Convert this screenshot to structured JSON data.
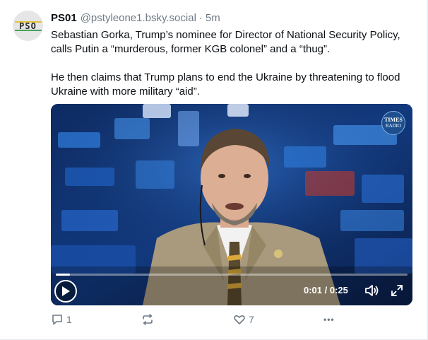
{
  "post": {
    "display_name": "PS01",
    "handle": "@pstyleone1.bsky.social",
    "separator": "·",
    "time": "5m",
    "avatar_text": "PSO",
    "text_paragraphs": [
      "Sebastian Gorka, Trump’s nominee for Director of National Security Policy, calls Putin a “murderous, former KGB colonel” and a “thug”.",
      "He then claims that Trump plans to end the Ukraine by threatening to flood Ukraine with more military “aid”."
    ]
  },
  "video": {
    "badge_line1": "TIMES",
    "badge_line2": "RADIO",
    "current_time": "0:01",
    "duration": "0:25",
    "time_display": "0:01 / 0:25",
    "progress_fraction": 0.04
  },
  "actions": {
    "reply_count": "1",
    "repost_count": "",
    "like_count": "7",
    "more_label": "•••"
  },
  "icons": {
    "reply": "speech-bubble-icon",
    "repost": "repost-arrows-icon",
    "like": "heart-icon",
    "more": "ellipsis-icon",
    "play": "play-icon",
    "volume": "speaker-icon",
    "fullscreen": "expand-icon"
  },
  "colors": {
    "muted_text": "#6f7a86",
    "body_text": "#0b0f14",
    "border": "#e4e8ec"
  }
}
